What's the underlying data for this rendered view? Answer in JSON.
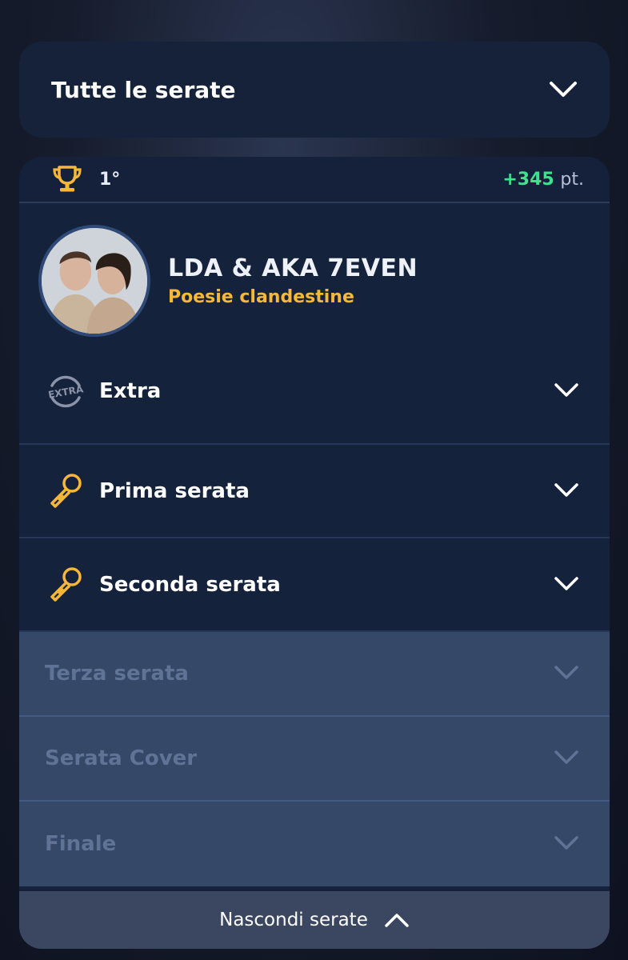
{
  "filter": {
    "label": "Tutte le serate",
    "icon": "chevron-down-icon"
  },
  "ranking": {
    "position": "1°",
    "points_value": "+345",
    "points_unit": "pt.",
    "trophy_color": "#f6b836",
    "points_color": "#3ee28d"
  },
  "artist": {
    "name": "LDA & AKA 7EVEN",
    "song": "Poesie clandestine",
    "song_color": "#f6b836"
  },
  "sections": [
    {
      "label": "Extra",
      "icon": "extra-badge-icon",
      "enabled": true
    },
    {
      "label": "Prima serata",
      "icon": "microphone-icon",
      "enabled": true
    },
    {
      "label": "Seconda serata",
      "icon": "microphone-icon",
      "enabled": true
    },
    {
      "label": "Terza serata",
      "enabled": false
    },
    {
      "label": "Serata Cover",
      "enabled": false
    },
    {
      "label": "Finale",
      "enabled": false
    }
  ],
  "footer": {
    "label": "Nascondi serate",
    "icon": "chevron-up-icon"
  }
}
